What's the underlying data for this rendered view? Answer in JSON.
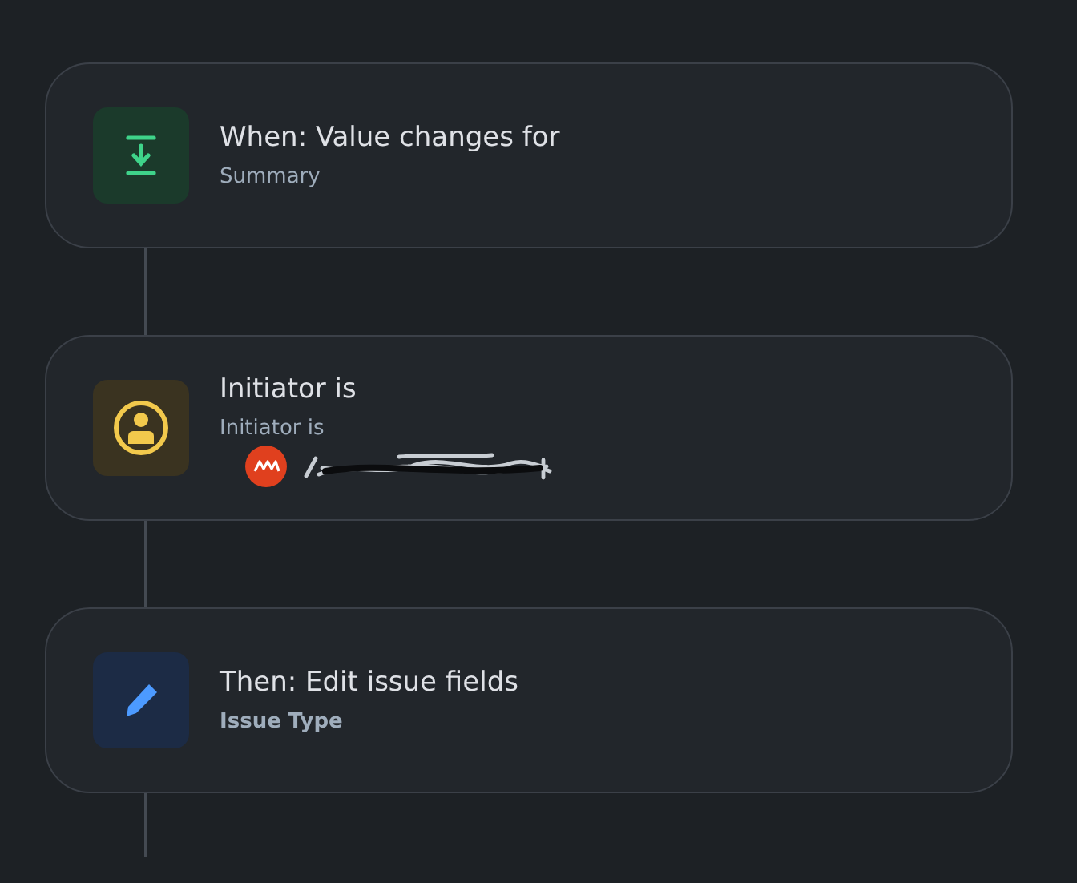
{
  "steps": [
    {
      "kind": "trigger",
      "title": "When: Value changes for",
      "subtitle": "Summary"
    },
    {
      "kind": "condition",
      "title": "Initiator is",
      "subtitle": "Initiator is"
    },
    {
      "kind": "action",
      "title": "Then: Edit issue fields",
      "subtitle": "Issue Type"
    }
  ]
}
